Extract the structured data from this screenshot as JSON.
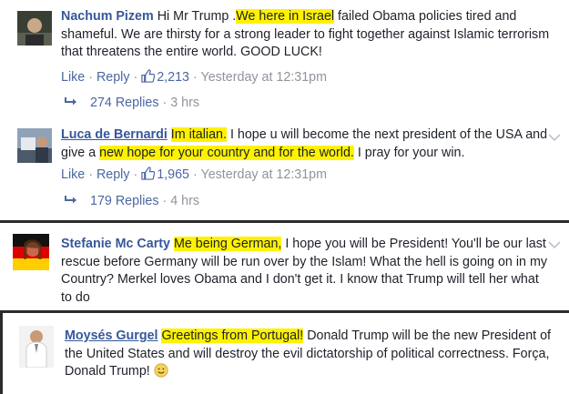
{
  "comments": [
    {
      "name": "Nachum Pizem",
      "segments": [
        {
          "t": "Hi Mr Trump .",
          "hl": false
        },
        {
          "t": "We here in Israel",
          "hl": true
        },
        {
          "t": " failed Obama policies tired and shameful. We are thirsty for a strong leader to fight together against Islamic terrorism that threatens the entire world. GOOD LUCK!",
          "hl": false
        }
      ],
      "like_label": "Like",
      "reply_label": "Reply",
      "like_count": "2,213",
      "timestamp": "Yesterday at 12:31pm",
      "replies_label": "274 Replies",
      "replies_time": "3 hrs"
    },
    {
      "name": "Luca de Bernardi",
      "segments": [
        {
          "t": "Im italian.",
          "hl": true
        },
        {
          "t": " I hope u will become the next president of the USA and give a ",
          "hl": false
        },
        {
          "t": "new hope for your country and for the world.",
          "hl": true
        },
        {
          "t": " I pray for your win.",
          "hl": false
        }
      ],
      "like_label": "Like",
      "reply_label": "Reply",
      "like_count": "1,965",
      "timestamp": "Yesterday at 12:31pm",
      "replies_label": "179 Replies",
      "replies_time": "4 hrs"
    },
    {
      "name": "Stefanie Mc Carty",
      "segments": [
        {
          "t": "Me being German,",
          "hl": true
        },
        {
          "t": " I hope you will be President! You'll be our last rescue before Germany will be run over by the Islam! What the hell is going on in my Country? Merkel loves Obama and I don't get it. I know that Trump will tell her what to do",
          "hl": false
        }
      ]
    },
    {
      "name": "Moysés Gurgel",
      "segments": [
        {
          "t": "Greetings from Portugal!",
          "hl": true
        },
        {
          "t": " Donald Trump will be the new President of the United States and will destroy the evil dictatorship of political correctness. Força, Donald Trump! ",
          "hl": false
        }
      ]
    }
  ],
  "icons": {
    "thumbs_up": "thumbs-up-icon",
    "reply_arrow": "reply-arrow-icon",
    "chevron": "chevron-down-icon",
    "smiley": "smiley-emoji-icon"
  },
  "colors": {
    "highlight": "#fff200",
    "name": "#365899",
    "link": "#4b67a1",
    "meta": "#90949c",
    "text": "#1d2129",
    "separator": "#2b2b2b"
  }
}
